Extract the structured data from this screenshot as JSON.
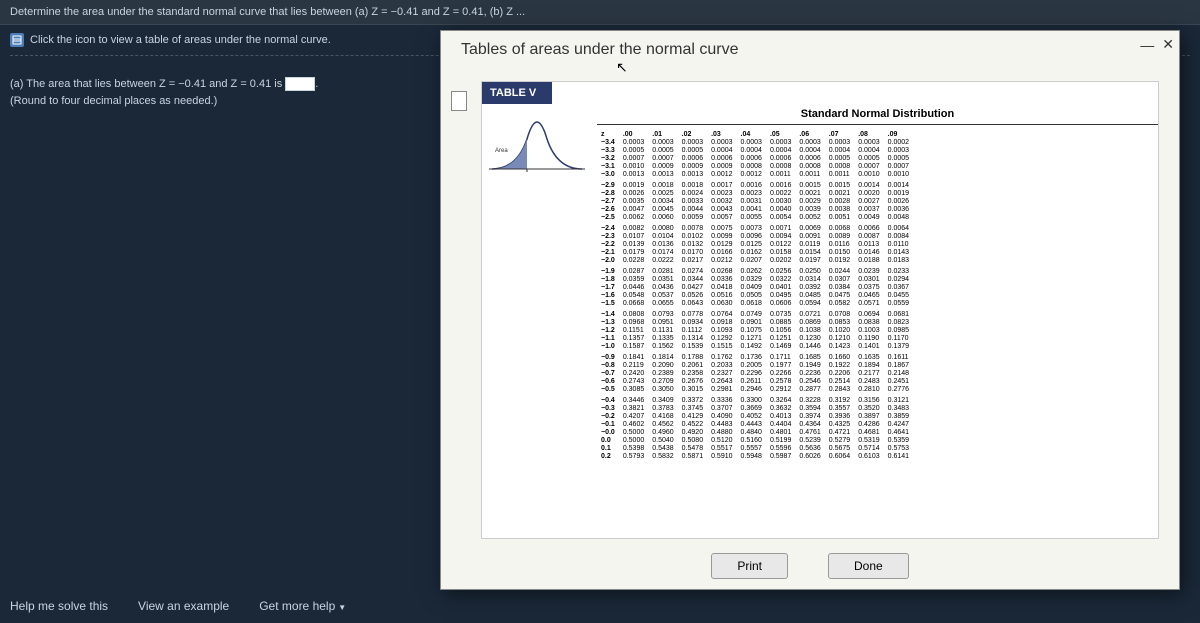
{
  "question_bar": "Determine the area under the standard normal curve that lies between (a) Z = −0.41 and Z = 0.41, (b) Z ...",
  "instruction": "Click the icon to view a table of areas under the normal curve.",
  "part_a": {
    "line1": "(a) The area that lies between Z = −0.41 and Z = 0.41 is",
    "line2": "(Round to four decimal places as needed.)"
  },
  "help": {
    "solve": "Help me solve this",
    "example": "View an example",
    "more": "Get more help"
  },
  "popup": {
    "title": "Tables of areas under the normal curve",
    "table_label": "TABLE V",
    "subtitle": "Standard Normal Distribution",
    "area_label": "Area",
    "print": "Print",
    "done": "Done"
  },
  "chart_data": {
    "type": "table",
    "title": "Standard Normal Distribution",
    "col_headers": [
      "z",
      ".00",
      ".01",
      ".02",
      ".03",
      ".04",
      ".05",
      ".06",
      ".07",
      ".08",
      ".09"
    ],
    "row_groups": [
      [
        {
          "z": "−3.4",
          "v": [
            "0.0003",
            "0.0003",
            "0.0003",
            "0.0003",
            "0.0003",
            "0.0003",
            "0.0003",
            "0.0003",
            "0.0003",
            "0.0002"
          ]
        },
        {
          "z": "−3.3",
          "v": [
            "0.0005",
            "0.0005",
            "0.0005",
            "0.0004",
            "0.0004",
            "0.0004",
            "0.0004",
            "0.0004",
            "0.0004",
            "0.0003"
          ]
        },
        {
          "z": "−3.2",
          "v": [
            "0.0007",
            "0.0007",
            "0.0006",
            "0.0006",
            "0.0006",
            "0.0006",
            "0.0006",
            "0.0005",
            "0.0005",
            "0.0005"
          ]
        },
        {
          "z": "−3.1",
          "v": [
            "0.0010",
            "0.0009",
            "0.0009",
            "0.0009",
            "0.0008",
            "0.0008",
            "0.0008",
            "0.0008",
            "0.0007",
            "0.0007"
          ]
        },
        {
          "z": "−3.0",
          "v": [
            "0.0013",
            "0.0013",
            "0.0013",
            "0.0012",
            "0.0012",
            "0.0011",
            "0.0011",
            "0.0011",
            "0.0010",
            "0.0010"
          ]
        }
      ],
      [
        {
          "z": "−2.9",
          "v": [
            "0.0019",
            "0.0018",
            "0.0018",
            "0.0017",
            "0.0016",
            "0.0016",
            "0.0015",
            "0.0015",
            "0.0014",
            "0.0014"
          ]
        },
        {
          "z": "−2.8",
          "v": [
            "0.0026",
            "0.0025",
            "0.0024",
            "0.0023",
            "0.0023",
            "0.0022",
            "0.0021",
            "0.0021",
            "0.0020",
            "0.0019"
          ]
        },
        {
          "z": "−2.7",
          "v": [
            "0.0035",
            "0.0034",
            "0.0033",
            "0.0032",
            "0.0031",
            "0.0030",
            "0.0029",
            "0.0028",
            "0.0027",
            "0.0026"
          ]
        },
        {
          "z": "−2.6",
          "v": [
            "0.0047",
            "0.0045",
            "0.0044",
            "0.0043",
            "0.0041",
            "0.0040",
            "0.0039",
            "0.0038",
            "0.0037",
            "0.0036"
          ]
        },
        {
          "z": "−2.5",
          "v": [
            "0.0062",
            "0.0060",
            "0.0059",
            "0.0057",
            "0.0055",
            "0.0054",
            "0.0052",
            "0.0051",
            "0.0049",
            "0.0048"
          ]
        }
      ],
      [
        {
          "z": "−2.4",
          "v": [
            "0.0082",
            "0.0080",
            "0.0078",
            "0.0075",
            "0.0073",
            "0.0071",
            "0.0069",
            "0.0068",
            "0.0066",
            "0.0064"
          ]
        },
        {
          "z": "−2.3",
          "v": [
            "0.0107",
            "0.0104",
            "0.0102",
            "0.0099",
            "0.0096",
            "0.0094",
            "0.0091",
            "0.0089",
            "0.0087",
            "0.0084"
          ]
        },
        {
          "z": "−2.2",
          "v": [
            "0.0139",
            "0.0136",
            "0.0132",
            "0.0129",
            "0.0125",
            "0.0122",
            "0.0119",
            "0.0116",
            "0.0113",
            "0.0110"
          ]
        },
        {
          "z": "−2.1",
          "v": [
            "0.0179",
            "0.0174",
            "0.0170",
            "0.0166",
            "0.0162",
            "0.0158",
            "0.0154",
            "0.0150",
            "0.0146",
            "0.0143"
          ]
        },
        {
          "z": "−2.0",
          "v": [
            "0.0228",
            "0.0222",
            "0.0217",
            "0.0212",
            "0.0207",
            "0.0202",
            "0.0197",
            "0.0192",
            "0.0188",
            "0.0183"
          ]
        }
      ],
      [
        {
          "z": "−1.9",
          "v": [
            "0.0287",
            "0.0281",
            "0.0274",
            "0.0268",
            "0.0262",
            "0.0256",
            "0.0250",
            "0.0244",
            "0.0239",
            "0.0233"
          ]
        },
        {
          "z": "−1.8",
          "v": [
            "0.0359",
            "0.0351",
            "0.0344",
            "0.0336",
            "0.0329",
            "0.0322",
            "0.0314",
            "0.0307",
            "0.0301",
            "0.0294"
          ]
        },
        {
          "z": "−1.7",
          "v": [
            "0.0446",
            "0.0436",
            "0.0427",
            "0.0418",
            "0.0409",
            "0.0401",
            "0.0392",
            "0.0384",
            "0.0375",
            "0.0367"
          ]
        },
        {
          "z": "−1.6",
          "v": [
            "0.0548",
            "0.0537",
            "0.0526",
            "0.0516",
            "0.0505",
            "0.0495",
            "0.0485",
            "0.0475",
            "0.0465",
            "0.0455"
          ]
        },
        {
          "z": "−1.5",
          "v": [
            "0.0668",
            "0.0655",
            "0.0643",
            "0.0630",
            "0.0618",
            "0.0606",
            "0.0594",
            "0.0582",
            "0.0571",
            "0.0559"
          ]
        }
      ],
      [
        {
          "z": "−1.4",
          "v": [
            "0.0808",
            "0.0793",
            "0.0778",
            "0.0764",
            "0.0749",
            "0.0735",
            "0.0721",
            "0.0708",
            "0.0694",
            "0.0681"
          ]
        },
        {
          "z": "−1.3",
          "v": [
            "0.0968",
            "0.0951",
            "0.0934",
            "0.0918",
            "0.0901",
            "0.0885",
            "0.0869",
            "0.0853",
            "0.0838",
            "0.0823"
          ]
        },
        {
          "z": "−1.2",
          "v": [
            "0.1151",
            "0.1131",
            "0.1112",
            "0.1093",
            "0.1075",
            "0.1056",
            "0.1038",
            "0.1020",
            "0.1003",
            "0.0985"
          ]
        },
        {
          "z": "−1.1",
          "v": [
            "0.1357",
            "0.1335",
            "0.1314",
            "0.1292",
            "0.1271",
            "0.1251",
            "0.1230",
            "0.1210",
            "0.1190",
            "0.1170"
          ]
        },
        {
          "z": "−1.0",
          "v": [
            "0.1587",
            "0.1562",
            "0.1539",
            "0.1515",
            "0.1492",
            "0.1469",
            "0.1446",
            "0.1423",
            "0.1401",
            "0.1379"
          ]
        }
      ],
      [
        {
          "z": "−0.9",
          "v": [
            "0.1841",
            "0.1814",
            "0.1788",
            "0.1762",
            "0.1736",
            "0.1711",
            "0.1685",
            "0.1660",
            "0.1635",
            "0.1611"
          ]
        },
        {
          "z": "−0.8",
          "v": [
            "0.2119",
            "0.2090",
            "0.2061",
            "0.2033",
            "0.2005",
            "0.1977",
            "0.1949",
            "0.1922",
            "0.1894",
            "0.1867"
          ]
        },
        {
          "z": "−0.7",
          "v": [
            "0.2420",
            "0.2389",
            "0.2358",
            "0.2327",
            "0.2296",
            "0.2266",
            "0.2236",
            "0.2206",
            "0.2177",
            "0.2148"
          ]
        },
        {
          "z": "−0.6",
          "v": [
            "0.2743",
            "0.2709",
            "0.2676",
            "0.2643",
            "0.2611",
            "0.2578",
            "0.2546",
            "0.2514",
            "0.2483",
            "0.2451"
          ]
        },
        {
          "z": "−0.5",
          "v": [
            "0.3085",
            "0.3050",
            "0.3015",
            "0.2981",
            "0.2946",
            "0.2912",
            "0.2877",
            "0.2843",
            "0.2810",
            "0.2776"
          ]
        }
      ],
      [
        {
          "z": "−0.4",
          "v": [
            "0.3446",
            "0.3409",
            "0.3372",
            "0.3336",
            "0.3300",
            "0.3264",
            "0.3228",
            "0.3192",
            "0.3156",
            "0.3121"
          ]
        },
        {
          "z": "−0.3",
          "v": [
            "0.3821",
            "0.3783",
            "0.3745",
            "0.3707",
            "0.3669",
            "0.3632",
            "0.3594",
            "0.3557",
            "0.3520",
            "0.3483"
          ]
        },
        {
          "z": "−0.2",
          "v": [
            "0.4207",
            "0.4168",
            "0.4129",
            "0.4090",
            "0.4052",
            "0.4013",
            "0.3974",
            "0.3936",
            "0.3897",
            "0.3859"
          ]
        },
        {
          "z": "−0.1",
          "v": [
            "0.4602",
            "0.4562",
            "0.4522",
            "0.4483",
            "0.4443",
            "0.4404",
            "0.4364",
            "0.4325",
            "0.4286",
            "0.4247"
          ]
        },
        {
          "z": "−0.0",
          "v": [
            "0.5000",
            "0.4960",
            "0.4920",
            "0.4880",
            "0.4840",
            "0.4801",
            "0.4761",
            "0.4721",
            "0.4681",
            "0.4641"
          ]
        },
        {
          "z": "0.0",
          "v": [
            "0.5000",
            "0.5040",
            "0.5080",
            "0.5120",
            "0.5160",
            "0.5199",
            "0.5239",
            "0.5279",
            "0.5319",
            "0.5359"
          ]
        },
        {
          "z": "0.1",
          "v": [
            "0.5398",
            "0.5438",
            "0.5478",
            "0.5517",
            "0.5557",
            "0.5596",
            "0.5636",
            "0.5675",
            "0.5714",
            "0.5753"
          ]
        },
        {
          "z": "0.2",
          "v": [
            "0.5793",
            "0.5832",
            "0.5871",
            "0.5910",
            "0.5948",
            "0.5987",
            "0.6026",
            "0.6064",
            "0.6103",
            "0.6141"
          ]
        }
      ]
    ]
  }
}
